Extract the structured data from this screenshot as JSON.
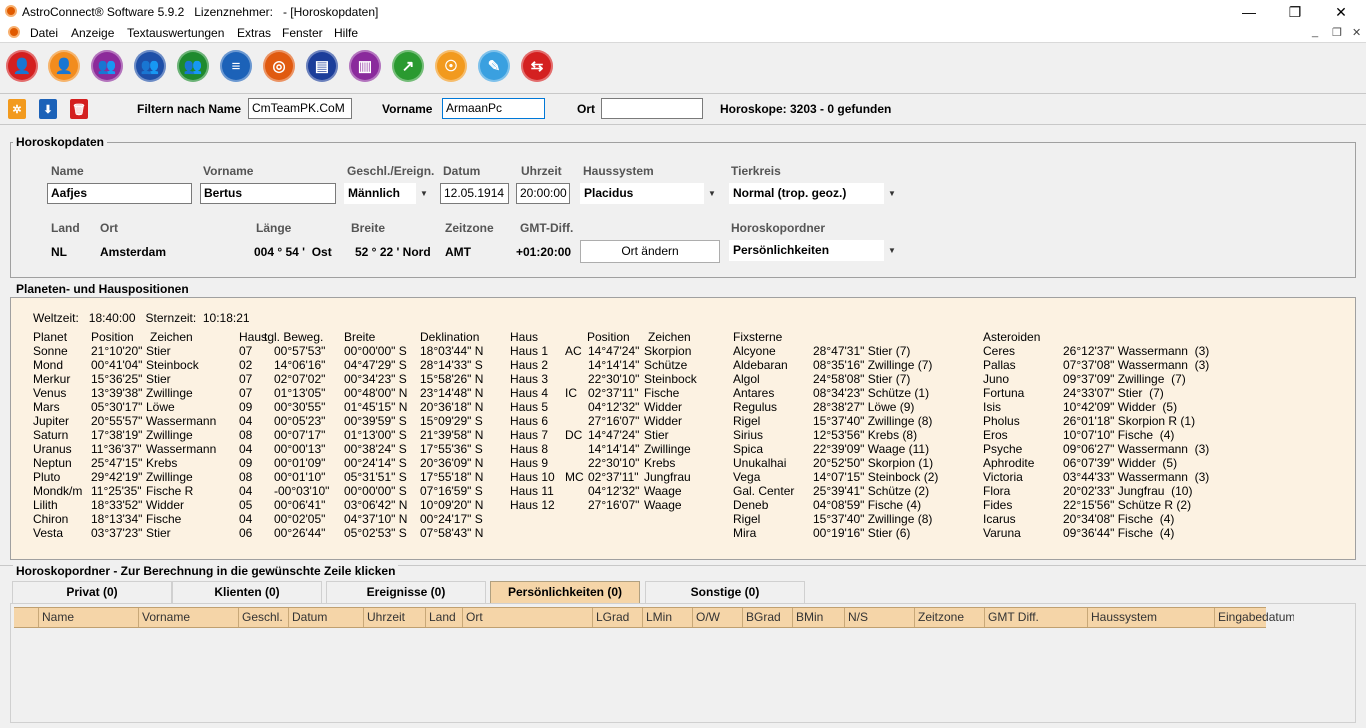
{
  "window": {
    "title": "AstroConnect® Software 5.9.2   Lizenznehmer:   - [Horoskopdaten]"
  },
  "menu": [
    "Datei",
    "Anzeige",
    "Textauswertungen",
    "Extras",
    "Fenster",
    "Hilfe"
  ],
  "toolbar_icons": [
    "person-red-icon",
    "person-orange-icon",
    "people-purple-icon",
    "people-blue-icon",
    "people-green-icon",
    "list-icon",
    "globe-icon",
    "card-icon",
    "book-icon",
    "chart-icon",
    "astrology-icon",
    "edit-icon",
    "exit-icon"
  ],
  "colors": {
    "tab_active": "#f5d5a8",
    "planet_bg": "#fcf2e2"
  },
  "filter": {
    "name_label": "Filtern nach Name",
    "name_value": "CmTeamPK.CoM",
    "vorname_label": "Vorname",
    "vorname_value": "ArmaanPc",
    "ort_label": "Ort",
    "ort_value": "",
    "count": "Horoskope: 3203  -  0 gefunden"
  },
  "horoskop": {
    "group_title": "Horoskopdaten",
    "name_label": "Name",
    "name": "Aafjes",
    "vorname_label": "Vorname",
    "vorname": "Bertus",
    "geschl_label": "Geschl./Ereign.",
    "geschl": "Männlich",
    "datum_label": "Datum",
    "datum": "12.05.1914",
    "uhrzeit_label": "Uhrzeit",
    "uhrzeit": "20:00:00",
    "haussystem_label": "Haussystem",
    "haussystem": "Placidus",
    "tierkreis_label": "Tierkreis",
    "tierkreis": "Normal (trop. geoz.)",
    "land_label": "Land",
    "land": "NL",
    "ort_label": "Ort",
    "ort": "Amsterdam",
    "laenge_label": "Länge",
    "laenge": "004 ° 54 '  Ost",
    "breite_label": "Breite",
    "breite": "52 ° 22 ' Nord",
    "zeitzone_label": "Zeitzone",
    "zeitzone": "AMT",
    "gmt_label": "GMT-Diff.",
    "gmt": "+01:20:00",
    "ort_button": "Ort ändern",
    "ordner_label": "Horoskopordner",
    "ordner": "Persönlichkeiten"
  },
  "positions": {
    "group_title": "Planeten- und Hauspositionen",
    "times": "Weltzeit:   18:40:00   Sternzeit:  10:18:21",
    "planet_cols": [
      "Planet",
      "Position",
      "Zeichen",
      "Haus",
      "tgl. Beweg.",
      "Breite",
      "Deklination"
    ],
    "planets": [
      [
        "Sonne",
        "21°10'20\"",
        "Stier",
        "07",
        "00°57'53\"",
        "00°00'00\" S",
        "18°03'44\" N"
      ],
      [
        "Mond",
        "00°41'04\"",
        "Steinbock",
        "02",
        "14°06'16\"",
        "04°47'29\" S",
        "28°14'33\" S"
      ],
      [
        "Merkur",
        "15°36'25\"",
        "Stier",
        "07",
        "02°07'02\"",
        "00°34'23\" S",
        "15°58'26\" N"
      ],
      [
        "Venus",
        "13°39'38\"",
        "Zwillinge",
        "07",
        "01°13'05\"",
        "00°48'00\" N",
        "23°14'48\" N"
      ],
      [
        "Mars",
        "05°30'17\"",
        "Löwe",
        "09",
        "00°30'55\"",
        "01°45'15\" N",
        "20°36'18\" N"
      ],
      [
        "Jupiter",
        "20°55'57\"",
        "Wassermann",
        "04",
        "00°05'23\"",
        "00°39'59\" S",
        "15°09'29\" S"
      ],
      [
        "Saturn",
        "17°38'19\"",
        "Zwillinge",
        "08",
        "00°07'17\"",
        "01°13'00\" S",
        "21°39'58\" N"
      ],
      [
        "Uranus",
        "11°36'37\"",
        "Wassermann",
        "04",
        "00°00'13\"",
        "00°38'24\" S",
        "17°55'36\" S"
      ],
      [
        "Neptun",
        "25°47'15\"",
        "Krebs",
        "09",
        "00°01'09\"",
        "00°24'14\" S",
        "20°36'09\" N"
      ],
      [
        "Pluto",
        "29°42'19\"",
        "Zwillinge",
        "08",
        "00°01'10\"",
        "05°31'51\" S",
        "17°55'18\" N"
      ],
      [
        "Mondk/m",
        "11°25'35\"",
        "Fische R",
        "04",
        "-00°03'10\"",
        "00°00'00\" S",
        "07°16'59\" S"
      ],
      [
        "Lilith",
        "18°33'52\"",
        "Widder",
        "05",
        "00°06'41\"",
        "03°06'42\" N",
        "10°09'20\" N"
      ],
      [
        "Chiron",
        "18°13'34\"",
        "Fische",
        "04",
        "00°02'05\"",
        "04°37'10\" N",
        "00°24'17\" S"
      ],
      [
        "Vesta",
        "03°37'23\"",
        "Stier",
        "06",
        "00°26'44\"",
        "05°02'53\" S",
        "07°58'43\" N"
      ]
    ],
    "haus_cols": [
      "Haus",
      "Position",
      "Zeichen"
    ],
    "houses": [
      [
        "Haus 1",
        "AC",
        "14°47'24\"",
        "Skorpion"
      ],
      [
        "Haus 2",
        "",
        "14°14'14\"",
        "Schütze"
      ],
      [
        "Haus 3",
        "",
        "22°30'10\"",
        "Steinbock"
      ],
      [
        "Haus 4",
        "IC",
        "02°37'11\"",
        "Fische"
      ],
      [
        "Haus 5",
        "",
        "04°12'32\"",
        "Widder"
      ],
      [
        "Haus 6",
        "",
        "27°16'07\"",
        "Widder"
      ],
      [
        "Haus 7",
        "DC",
        "14°47'24\"",
        "Stier"
      ],
      [
        "Haus 8",
        "",
        "14°14'14\"",
        "Zwillinge"
      ],
      [
        "Haus 9",
        "",
        "22°30'10\"",
        "Krebs"
      ],
      [
        "Haus 10",
        "MC",
        "02°37'11\"",
        "Jungfrau"
      ],
      [
        "Haus 11",
        "",
        "04°12'32\"",
        "Waage"
      ],
      [
        "Haus 12",
        "",
        "27°16'07\"",
        "Waage"
      ]
    ],
    "fix_title": "Fixsterne",
    "fixsterne": [
      [
        "Alcyone",
        "28°47'31\" Stier (7)"
      ],
      [
        "Aldebaran",
        "08°35'16\" Zwillinge (7)"
      ],
      [
        "Algol",
        "24°58'08\" Stier (7)"
      ],
      [
        "Antares",
        "08°34'23\" Schütze (1)"
      ],
      [
        "Regulus",
        "28°38'27\" Löwe (9)"
      ],
      [
        "Rigel",
        "15°37'40\" Zwillinge (8)"
      ],
      [
        "Sirius",
        "12°53'56\" Krebs (8)"
      ],
      [
        "Spica",
        "22°39'09\" Waage (11)"
      ],
      [
        "Unukalhai",
        "20°52'50\" Skorpion (1)"
      ],
      [
        "Vega",
        "14°07'15\" Steinbock (2)"
      ],
      [
        "Gal. Center",
        "25°39'41\" Schütze (2)"
      ],
      [
        "Deneb",
        "04°08'59\" Fische (4)"
      ],
      [
        "Rigel",
        "15°37'40\" Zwillinge (8)"
      ],
      [
        "Mira",
        "00°19'16\" Stier (6)"
      ]
    ],
    "ast_title": "Asteroiden",
    "asteroiden": [
      [
        "Ceres",
        "26°12'37\" Wassermann  (3)"
      ],
      [
        "Pallas",
        "07°37'08\" Wassermann  (3)"
      ],
      [
        "Juno",
        "09°37'09\" Zwillinge  (7)"
      ],
      [
        "Fortuna",
        "24°33'07\" Stier  (7)"
      ],
      [
        "Isis",
        "10°42'09\" Widder  (5)"
      ],
      [
        "Pholus",
        "26°01'18\" Skorpion R (1)"
      ],
      [
        "Eros",
        "10°07'10\" Fische  (4)"
      ],
      [
        "Psyche",
        "09°06'27\" Wassermann  (3)"
      ],
      [
        "Aphrodite",
        "06°07'39\" Widder  (5)"
      ],
      [
        "Victoria",
        "03°44'33\" Wassermann  (3)"
      ],
      [
        "Flora",
        "20°02'33\" Jungfrau  (10)"
      ],
      [
        "Fides",
        "22°15'56\" Schütze R (2)"
      ],
      [
        "Icarus",
        "20°34'08\" Fische  (4)"
      ],
      [
        "Varuna",
        "09°36'44\" Fische  (4)"
      ]
    ]
  },
  "ordner": {
    "group_title": "Horoskopordner - Zur Berechnung in die gewünschte Zeile klicken",
    "tabs": [
      "Privat (0)",
      "Klienten (0)",
      "Ereignisse (0)",
      "Persönlichkeiten (0)",
      "Sonstige (0)"
    ],
    "columns": [
      "Name",
      "Vorname",
      "Geschl.",
      "Datum",
      "Uhrzeit",
      "Land",
      "Ort",
      "LGrad",
      "LMin",
      "O/W",
      "BGrad",
      "BMin",
      "N/S",
      "Zeitzone",
      "GMT Diff.",
      "Haussystem",
      "Eingabedatum"
    ]
  }
}
